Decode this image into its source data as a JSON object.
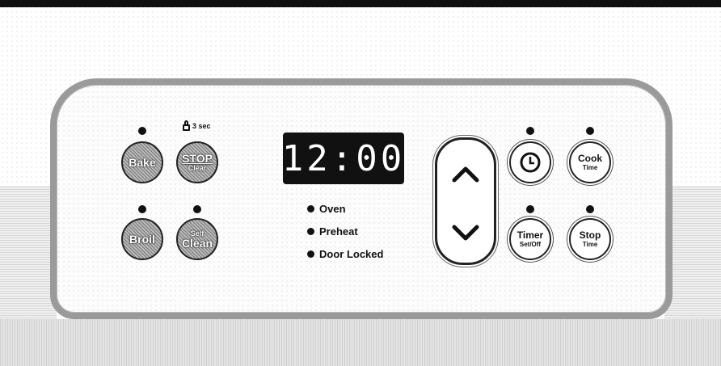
{
  "display": {
    "time": "12:00"
  },
  "lock_label": "3 sec",
  "buttons": {
    "bake": {
      "main": "Bake"
    },
    "stop_clear": {
      "main": "STOP",
      "sub": "Clear"
    },
    "broil": {
      "main": "Broil"
    },
    "self_clean": {
      "sub": "Self",
      "main": "Clean"
    },
    "cook_time": {
      "main": "Cook",
      "sub": "Time"
    },
    "timer": {
      "main": "Timer",
      "sub": "Set/Off"
    },
    "stop_time": {
      "main": "Stop",
      "sub": "Time"
    }
  },
  "indicators": [
    {
      "label": "Oven"
    },
    {
      "label": "Preheat"
    },
    {
      "label": "Door Locked"
    }
  ],
  "icons": {
    "clock": "clock-icon",
    "up": "chevron-up-icon",
    "down": "chevron-down-icon",
    "lock": "lock-icon"
  }
}
